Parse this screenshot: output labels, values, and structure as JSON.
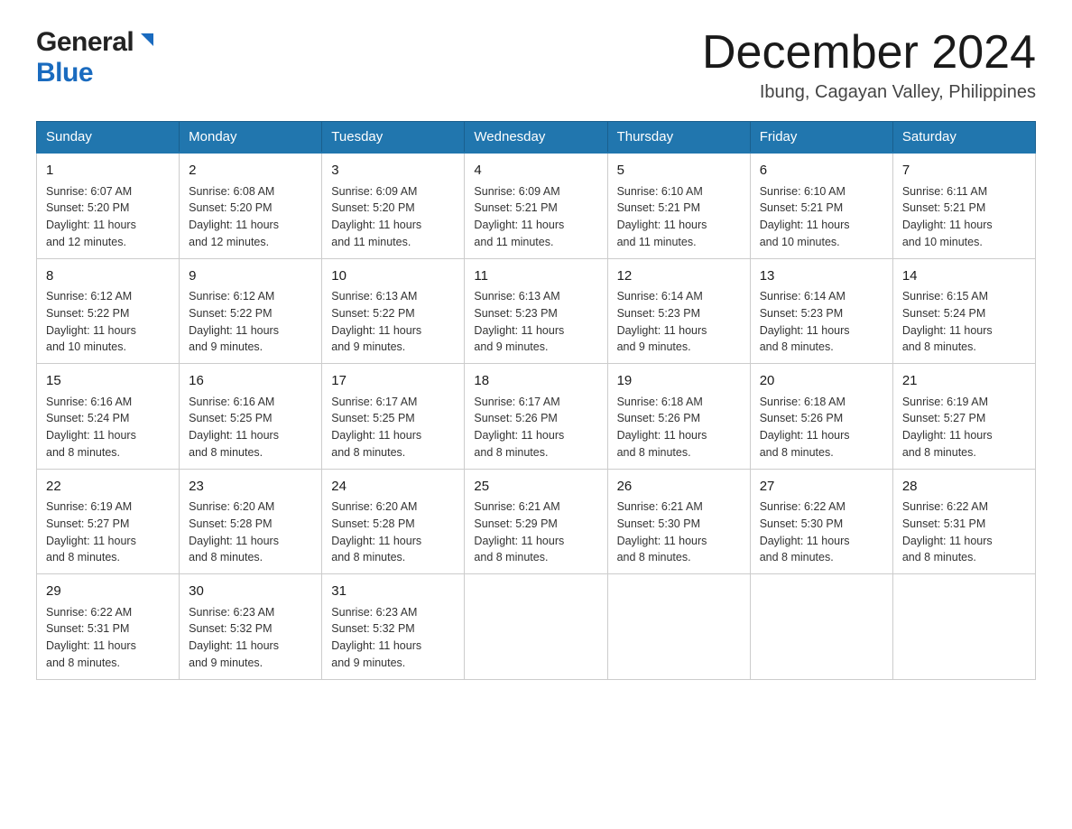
{
  "header": {
    "logo_general": "General",
    "logo_blue": "Blue",
    "month_title": "December 2024",
    "location": "Ibung, Cagayan Valley, Philippines"
  },
  "days_of_week": [
    "Sunday",
    "Monday",
    "Tuesday",
    "Wednesday",
    "Thursday",
    "Friday",
    "Saturday"
  ],
  "weeks": [
    [
      {
        "day": "1",
        "sunrise": "6:07 AM",
        "sunset": "5:20 PM",
        "daylight": "11 hours and 12 minutes."
      },
      {
        "day": "2",
        "sunrise": "6:08 AM",
        "sunset": "5:20 PM",
        "daylight": "11 hours and 12 minutes."
      },
      {
        "day": "3",
        "sunrise": "6:09 AM",
        "sunset": "5:20 PM",
        "daylight": "11 hours and 11 minutes."
      },
      {
        "day": "4",
        "sunrise": "6:09 AM",
        "sunset": "5:21 PM",
        "daylight": "11 hours and 11 minutes."
      },
      {
        "day": "5",
        "sunrise": "6:10 AM",
        "sunset": "5:21 PM",
        "daylight": "11 hours and 11 minutes."
      },
      {
        "day": "6",
        "sunrise": "6:10 AM",
        "sunset": "5:21 PM",
        "daylight": "11 hours and 10 minutes."
      },
      {
        "day": "7",
        "sunrise": "6:11 AM",
        "sunset": "5:21 PM",
        "daylight": "11 hours and 10 minutes."
      }
    ],
    [
      {
        "day": "8",
        "sunrise": "6:12 AM",
        "sunset": "5:22 PM",
        "daylight": "11 hours and 10 minutes."
      },
      {
        "day": "9",
        "sunrise": "6:12 AM",
        "sunset": "5:22 PM",
        "daylight": "11 hours and 9 minutes."
      },
      {
        "day": "10",
        "sunrise": "6:13 AM",
        "sunset": "5:22 PM",
        "daylight": "11 hours and 9 minutes."
      },
      {
        "day": "11",
        "sunrise": "6:13 AM",
        "sunset": "5:23 PM",
        "daylight": "11 hours and 9 minutes."
      },
      {
        "day": "12",
        "sunrise": "6:14 AM",
        "sunset": "5:23 PM",
        "daylight": "11 hours and 9 minutes."
      },
      {
        "day": "13",
        "sunrise": "6:14 AM",
        "sunset": "5:23 PM",
        "daylight": "11 hours and 8 minutes."
      },
      {
        "day": "14",
        "sunrise": "6:15 AM",
        "sunset": "5:24 PM",
        "daylight": "11 hours and 8 minutes."
      }
    ],
    [
      {
        "day": "15",
        "sunrise": "6:16 AM",
        "sunset": "5:24 PM",
        "daylight": "11 hours and 8 minutes."
      },
      {
        "day": "16",
        "sunrise": "6:16 AM",
        "sunset": "5:25 PM",
        "daylight": "11 hours and 8 minutes."
      },
      {
        "day": "17",
        "sunrise": "6:17 AM",
        "sunset": "5:25 PM",
        "daylight": "11 hours and 8 minutes."
      },
      {
        "day": "18",
        "sunrise": "6:17 AM",
        "sunset": "5:26 PM",
        "daylight": "11 hours and 8 minutes."
      },
      {
        "day": "19",
        "sunrise": "6:18 AM",
        "sunset": "5:26 PM",
        "daylight": "11 hours and 8 minutes."
      },
      {
        "day": "20",
        "sunrise": "6:18 AM",
        "sunset": "5:26 PM",
        "daylight": "11 hours and 8 minutes."
      },
      {
        "day": "21",
        "sunrise": "6:19 AM",
        "sunset": "5:27 PM",
        "daylight": "11 hours and 8 minutes."
      }
    ],
    [
      {
        "day": "22",
        "sunrise": "6:19 AM",
        "sunset": "5:27 PM",
        "daylight": "11 hours and 8 minutes."
      },
      {
        "day": "23",
        "sunrise": "6:20 AM",
        "sunset": "5:28 PM",
        "daylight": "11 hours and 8 minutes."
      },
      {
        "day": "24",
        "sunrise": "6:20 AM",
        "sunset": "5:28 PM",
        "daylight": "11 hours and 8 minutes."
      },
      {
        "day": "25",
        "sunrise": "6:21 AM",
        "sunset": "5:29 PM",
        "daylight": "11 hours and 8 minutes."
      },
      {
        "day": "26",
        "sunrise": "6:21 AM",
        "sunset": "5:30 PM",
        "daylight": "11 hours and 8 minutes."
      },
      {
        "day": "27",
        "sunrise": "6:22 AM",
        "sunset": "5:30 PM",
        "daylight": "11 hours and 8 minutes."
      },
      {
        "day": "28",
        "sunrise": "6:22 AM",
        "sunset": "5:31 PM",
        "daylight": "11 hours and 8 minutes."
      }
    ],
    [
      {
        "day": "29",
        "sunrise": "6:22 AM",
        "sunset": "5:31 PM",
        "daylight": "11 hours and 8 minutes."
      },
      {
        "day": "30",
        "sunrise": "6:23 AM",
        "sunset": "5:32 PM",
        "daylight": "11 hours and 9 minutes."
      },
      {
        "day": "31",
        "sunrise": "6:23 AM",
        "sunset": "5:32 PM",
        "daylight": "11 hours and 9 minutes."
      },
      null,
      null,
      null,
      null
    ]
  ],
  "labels": {
    "sunrise": "Sunrise:",
    "sunset": "Sunset:",
    "daylight": "Daylight:"
  }
}
